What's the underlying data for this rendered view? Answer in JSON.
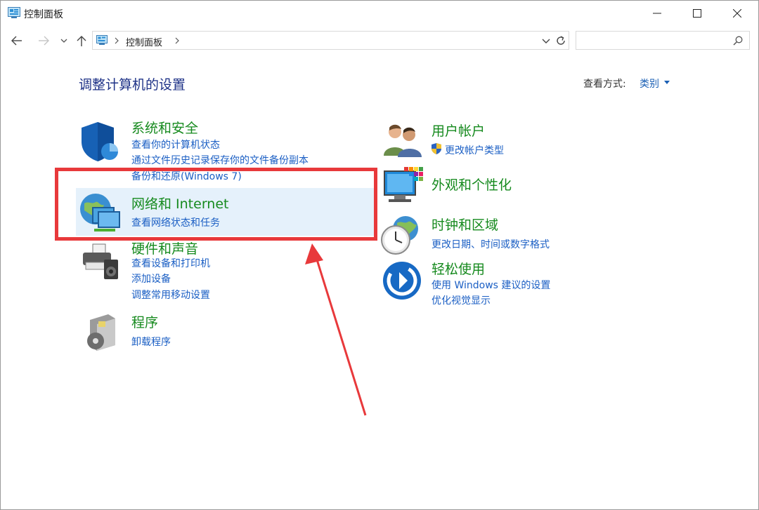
{
  "window": {
    "title": "控制面板",
    "buttons": [
      "minimize-icon",
      "maximize-icon",
      "close-icon"
    ]
  },
  "address": {
    "breadcrumb": "控制面板",
    "search_placeholder": ""
  },
  "header": {
    "title": "调整计算机的设置",
    "view_by_label": "查看方式:",
    "view_by_value": "类别"
  },
  "categories": {
    "system": {
      "title": "系统和安全",
      "links": [
        "查看你的计算机状态",
        "通过文件历史记录保存你的文件备份副本",
        "备份和还原(Windows 7)"
      ]
    },
    "network": {
      "title": "网络和 Internet",
      "links": [
        "查看网络状态和任务"
      ]
    },
    "hardware": {
      "title": "硬件和声音",
      "links": [
        "查看设备和打印机",
        "添加设备",
        "调整常用移动设置"
      ]
    },
    "programs": {
      "title": "程序",
      "links": [
        "卸载程序"
      ]
    },
    "users": {
      "title": "用户帐户",
      "links": [
        "更改帐户类型"
      ]
    },
    "appearance": {
      "title": "外观和个性化",
      "links": []
    },
    "clock": {
      "title": "时钟和区域",
      "links": [
        "更改日期、时间或数字格式"
      ]
    },
    "ease": {
      "title": "轻松使用",
      "links": [
        "使用 Windows 建议的设置",
        "优化视觉显示"
      ]
    }
  },
  "colors": {
    "category_title": "#168a1e",
    "link": "#1b5fc4",
    "heading": "#1e3287",
    "highlight": "#e5f1fb",
    "annotation": "#e8393b"
  }
}
